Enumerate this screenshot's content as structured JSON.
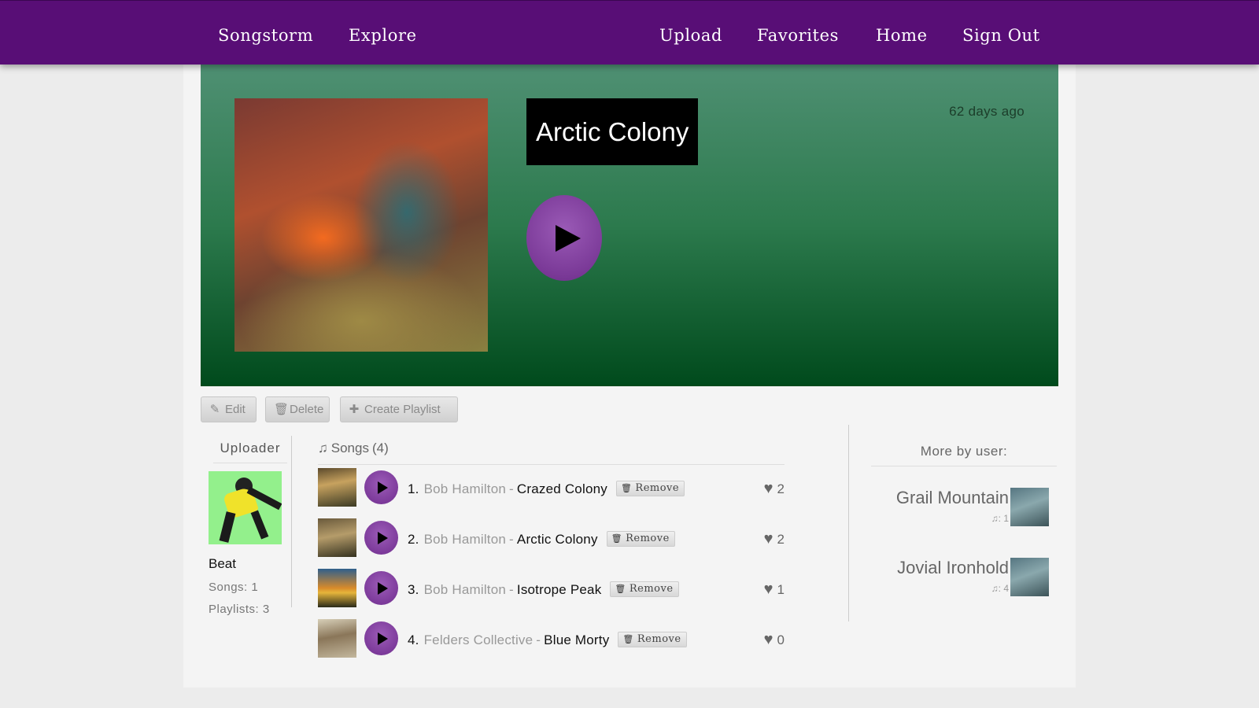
{
  "nav": {
    "brand": "Songstorm",
    "explore": "Explore",
    "upload": "Upload",
    "favorites": "Favorites",
    "home": "Home",
    "sign_out": "Sign Out"
  },
  "playlist": {
    "title": "Arctic Colony",
    "posted": "62 days ago"
  },
  "actions": {
    "edit": "Edit",
    "delete": "Delete",
    "create_playlist": "Create Playlist"
  },
  "uploader": {
    "heading": "Uploader",
    "name": "Beat",
    "songs": "Songs: 1",
    "playlists": "Playlists: 3"
  },
  "songs": {
    "heading": "Songs",
    "count": "(4)",
    "remove_label": "Remove",
    "separator": "-",
    "items": [
      {
        "number": "1.",
        "artist": "Bob Hamilton",
        "title": "Crazed Colony",
        "likes": "2"
      },
      {
        "number": "2.",
        "artist": "Bob Hamilton",
        "title": "Arctic Colony",
        "likes": "2"
      },
      {
        "number": "3.",
        "artist": "Bob Hamilton",
        "title": "Isotrope Peak",
        "likes": "1"
      },
      {
        "number": "4.",
        "artist": "Felders Collective",
        "title": "Blue Morty",
        "likes": "0"
      }
    ]
  },
  "more_by_user": {
    "heading": "More by user:",
    "items": [
      {
        "name": "Grail Mountain",
        "song_count": "1"
      },
      {
        "name": "Jovial Ironhold",
        "song_count": "4"
      }
    ]
  },
  "icons": {
    "edit": "edit-icon",
    "delete": "trash-icon",
    "create": "plus-icon",
    "music": "music-note-icon",
    "like": "heart-icon",
    "play": "play-icon"
  },
  "colors": {
    "nav": "#580e76",
    "accent_purple": "#7b3a98",
    "hero_top": "#4f9073",
    "hero_bottom": "#004a1c"
  }
}
